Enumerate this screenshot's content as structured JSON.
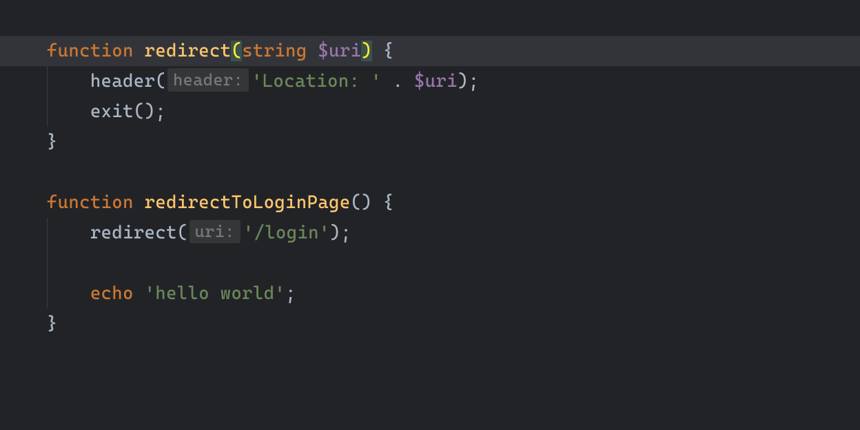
{
  "code": {
    "l1": {
      "kw_function": "function ",
      "fn_name": "redirect",
      "paren_open": "(",
      "kw_type": "string ",
      "var": "$uri",
      "paren_close": ")",
      "rest": " {"
    },
    "l2": {
      "indent": "    ",
      "call": "header",
      "paren_open": "(",
      "hint": "header:",
      "str": "'Location: '",
      "concat": " . ",
      "var": "$uri",
      "rest": ");"
    },
    "l3": {
      "indent": "    ",
      "call": "exit",
      "rest": "();"
    },
    "l4": {
      "brace": "}"
    },
    "l6": {
      "kw_function": "function ",
      "fn_name": "redirectToLoginPage",
      "rest": "() {"
    },
    "l7": {
      "indent": "    ",
      "call": "redirect",
      "paren_open": "(",
      "hint": "uri:",
      "str": "'/login'",
      "rest": ");"
    },
    "l9": {
      "indent": "    ",
      "kw_echo": "echo ",
      "str": "'hello world'",
      "rest": ";"
    },
    "l10": {
      "brace": "}"
    }
  }
}
